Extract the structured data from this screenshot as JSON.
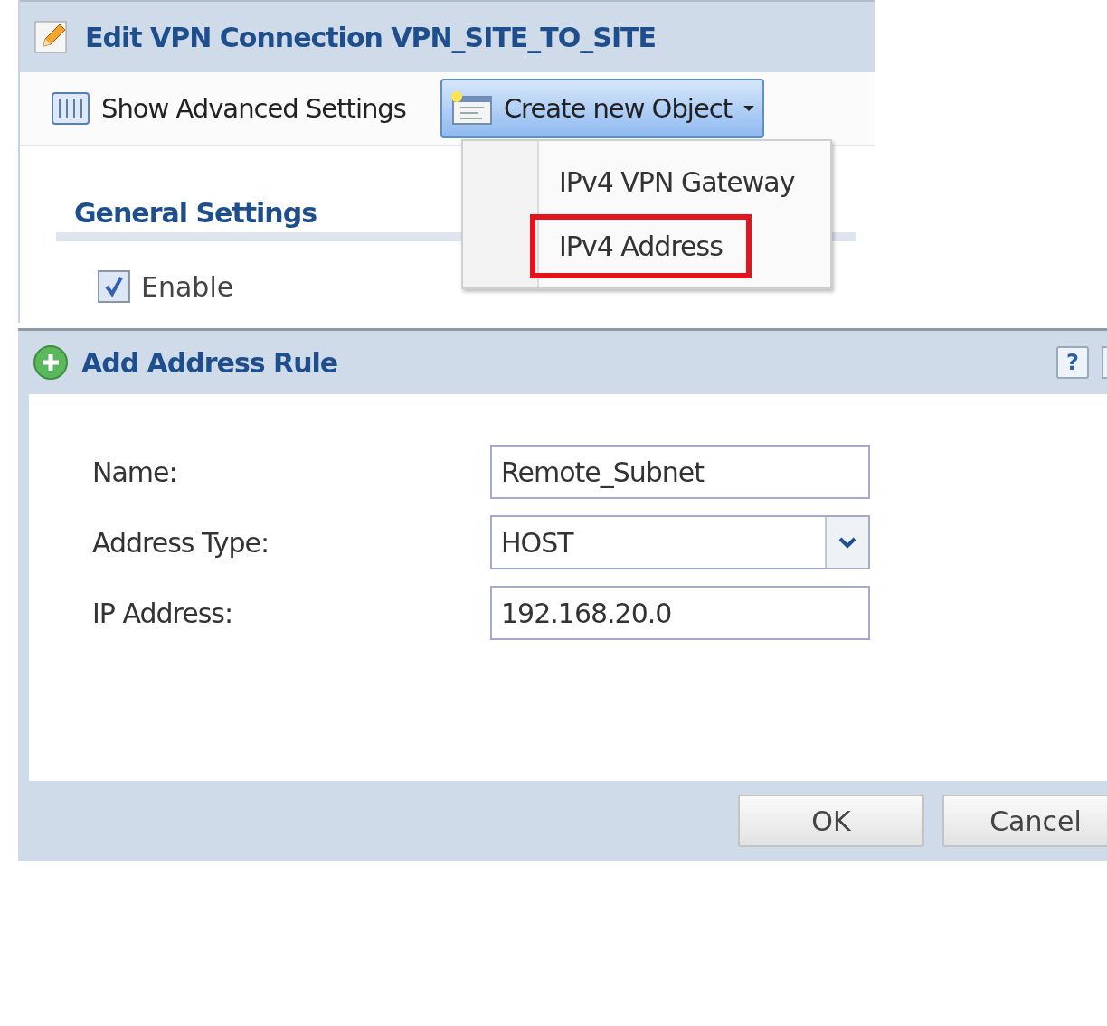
{
  "edit_window": {
    "title": "Edit VPN Connection VPN_SITE_TO_SITE"
  },
  "toolbar": {
    "items": [
      {
        "label": "Show Advanced Settings",
        "kind": "button",
        "active": false
      },
      {
        "label": "Create new Object",
        "kind": "menu",
        "active": true
      }
    ]
  },
  "menu": {
    "items": [
      {
        "label": "IPv4 VPN Gateway",
        "highlighted": false
      },
      {
        "label": "IPv4 Address",
        "highlighted": true
      }
    ]
  },
  "section": {
    "title": "General Settings"
  },
  "enable": {
    "label": "Enable",
    "checked": true
  },
  "dialog": {
    "title": "Add Address Rule",
    "help": "?",
    "fields": [
      {
        "label": "Name:",
        "kind": "text",
        "value": "Remote_Subnet"
      },
      {
        "label": "Address Type:",
        "kind": "select",
        "value": "HOST"
      },
      {
        "label": "IP Address:",
        "kind": "text",
        "value": "192.168.20.0"
      }
    ],
    "buttons": [
      "OK",
      "Cancel"
    ]
  }
}
